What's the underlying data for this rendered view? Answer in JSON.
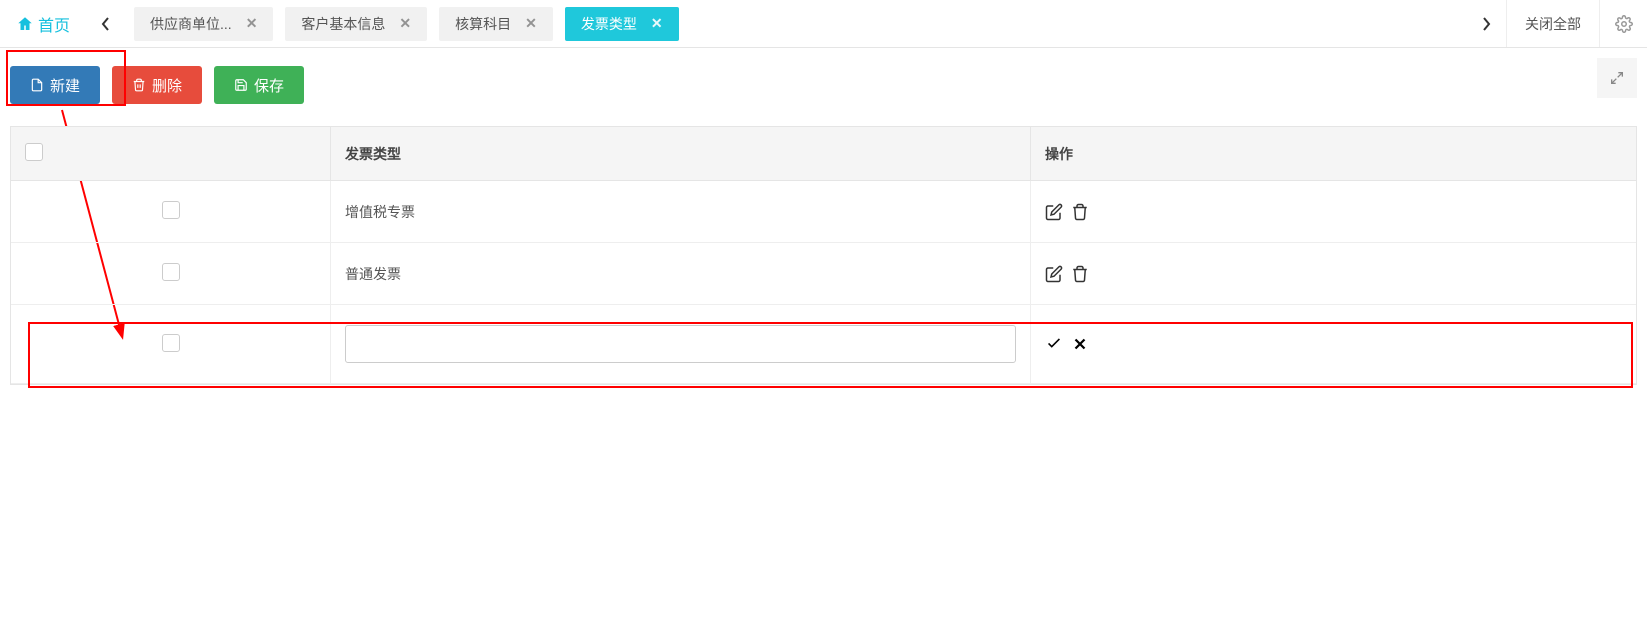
{
  "header": {
    "home_label": "首页",
    "close_all_label": "关闭全部"
  },
  "tabs": [
    {
      "label": "供应商单位...",
      "active": false
    },
    {
      "label": "客户基本信息",
      "active": false
    },
    {
      "label": "核算科目",
      "active": false
    },
    {
      "label": "发票类型",
      "active": true
    }
  ],
  "toolbar": {
    "new_label": "新建",
    "delete_label": "删除",
    "save_label": "保存"
  },
  "table": {
    "columns": {
      "type_header": "发票类型",
      "ops_header": "操作"
    },
    "rows": [
      {
        "type": "增值税专票",
        "mode": "view"
      },
      {
        "type": "普通发票",
        "mode": "view"
      },
      {
        "type": "",
        "mode": "edit"
      }
    ]
  },
  "icons": {
    "home": "home-icon",
    "gear": "gear-icon",
    "file": "file-icon",
    "trash": "trash-icon",
    "save": "save-icon",
    "edit": "edit-icon",
    "check": "check-icon",
    "cross": "cross-icon",
    "expand": "expand-icon"
  }
}
